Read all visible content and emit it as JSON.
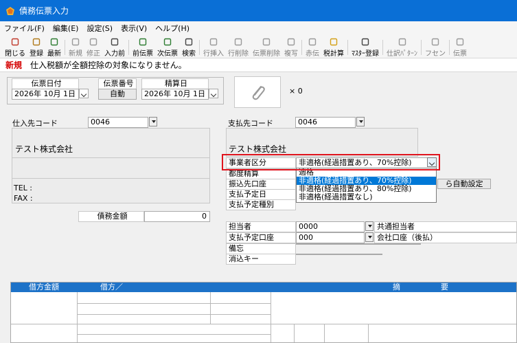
{
  "window": {
    "title": "債務伝票入力"
  },
  "menu": [
    "ファイル(F)",
    "編集(E)",
    "設定(S)",
    "表示(V)",
    "ヘルプ(H)"
  ],
  "toolbar": [
    {
      "label": "閉じる",
      "icon": "close-icon",
      "color": "#c0392b",
      "enabled": true
    },
    {
      "label": "登録",
      "icon": "save-icon",
      "color": "#b07a1c",
      "enabled": true
    },
    {
      "label": "最新",
      "icon": "refresh-icon",
      "color": "#2e7d32",
      "enabled": true
    },
    {
      "label": "新規",
      "icon": "new-doc-icon",
      "color": "#9a9a9a",
      "enabled": false
    },
    {
      "label": "修正",
      "icon": "edit-icon",
      "color": "#9a9a9a",
      "enabled": false
    },
    {
      "label": "入力前",
      "icon": "before-input-icon",
      "color": "#444",
      "enabled": true
    },
    {
      "label": "前伝票",
      "icon": "prev-slip-icon",
      "color": "#2e7d32",
      "enabled": true
    },
    {
      "label": "次伝票",
      "icon": "next-slip-icon",
      "color": "#2e7d32",
      "enabled": true
    },
    {
      "label": "検索",
      "icon": "search-icon",
      "color": "#444",
      "enabled": true
    },
    {
      "label": "行挿入",
      "icon": "insert-row-icon",
      "color": "#9a9a9a",
      "enabled": false
    },
    {
      "label": "行削除",
      "icon": "delete-row-icon",
      "color": "#9a9a9a",
      "enabled": false
    },
    {
      "label": "伝票削除",
      "icon": "delete-slip-icon",
      "color": "#9a9a9a",
      "enabled": false
    },
    {
      "label": "複写",
      "icon": "copy-icon",
      "color": "#9a9a9a",
      "enabled": false
    },
    {
      "label": "赤伝",
      "icon": "red-slip-icon",
      "color": "#9a9a9a",
      "enabled": false
    },
    {
      "label": "税計算",
      "icon": "tax-calc-icon",
      "color": "#d4a017",
      "enabled": true
    },
    {
      "label": "ﾏｽﾀｰ登録",
      "icon": "master-register-icon",
      "color": "#444",
      "enabled": true
    },
    {
      "label": "仕訳ﾊﾟﾀｰﾝ",
      "icon": "journal-pattern-icon",
      "color": "#9a9a9a",
      "enabled": false
    },
    {
      "label": "フセン",
      "icon": "sticky-note-icon",
      "color": "#9a9a9a",
      "enabled": false
    },
    {
      "label": "伝票",
      "icon": "slip-icon",
      "color": "#9a9a9a",
      "enabled": false
    }
  ],
  "status": {
    "mode": "新規",
    "message": "仕入税額が全額控除の対象になりません。"
  },
  "header": {
    "slip_date_label": "伝票日付",
    "slip_date_value": "2026年 10月  1日",
    "slip_no_label": "伝票番号",
    "slip_no_button": "自動",
    "settle_date_label": "精算日",
    "settle_date_value": "2026年 10月  1日",
    "attachment_count": "× 0"
  },
  "supplier": {
    "code_label": "仕入先コード",
    "code_value": "0046",
    "name": "テスト株式会社",
    "tel_label": "TEL :",
    "fax_label": "FAX :"
  },
  "payee": {
    "code_label": "支払先コード",
    "code_value": "0046",
    "name": "テスト株式会社",
    "business_type_label": "事業者区分",
    "business_type_value": "非適格(経過措置あり、70%控除)",
    "business_type_options": [
      "適格",
      "非適格(経過措置あり、70%控除)",
      "非適格(経過措置あり、80%控除)",
      "非適格(経過措置なし)"
    ],
    "business_type_selected": 1,
    "rows": [
      "都度精算",
      "振込先口座",
      "支払予定日",
      "支払予定種別"
    ],
    "auto_set_button": "ら自動設定"
  },
  "amount": {
    "label": "債務金額",
    "value": "0"
  },
  "assignee": {
    "rows": [
      {
        "label": "担当者",
        "code": "0000",
        "name": "共通担当者"
      },
      {
        "label": "支払予定口座",
        "code": "000",
        "name": "会社口座（後払）"
      }
    ],
    "note_label": "備忘",
    "clear_key_label": "消込キー"
  },
  "grid": {
    "headers": [
      "借方金額",
      "借方／",
      "摘",
      "要"
    ]
  },
  "colors": {
    "titlebar": "#0a6fd6",
    "highlight": "#e0141e",
    "selected": "#0078d7",
    "grid_header": "#1d72c8"
  }
}
